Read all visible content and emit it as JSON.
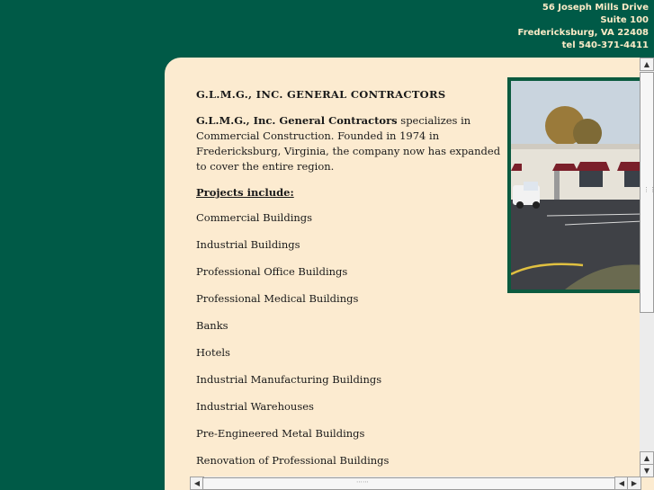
{
  "address": {
    "street": "56 Joseph Mills Drive",
    "suite": "Suite 100",
    "city": "Fredericksburg, VA  22408",
    "tel": "tel 540-371-4411"
  },
  "content": {
    "heading": "G.L.M.G., INC. GENERAL CONTRACTORS",
    "intro_bold": "G.L.M.G., Inc. General Contractors",
    "intro_rest": " specializes in Commercial Construction.  Founded in 1974 in Fredericksburg, Virginia, the company now has expanded to cover the entire region.",
    "projects_label": "Projects include:",
    "projects": [
      "Commercial Buildings",
      "Industrial Buildings",
      "Professional Office Buildings",
      "Professional Medical Buildings",
      "Banks",
      "Hotels",
      "Industrial Manufacturing Buildings",
      "Industrial Warehouses",
      "Pre-Engineered Metal Buildings",
      "Renovation of Professional Buildings"
    ]
  },
  "photo": {
    "subject": "commercial-building-photo"
  },
  "colors": {
    "page_bg": "#005a47",
    "panel_bg": "#fcebd0",
    "address_text": "#fcebc7",
    "frame": "#0b5a3f"
  },
  "scrollbars": {
    "up_arrow": "▲",
    "down_arrow": "▼",
    "left_arrow": "◀",
    "right_arrow": "▶"
  }
}
